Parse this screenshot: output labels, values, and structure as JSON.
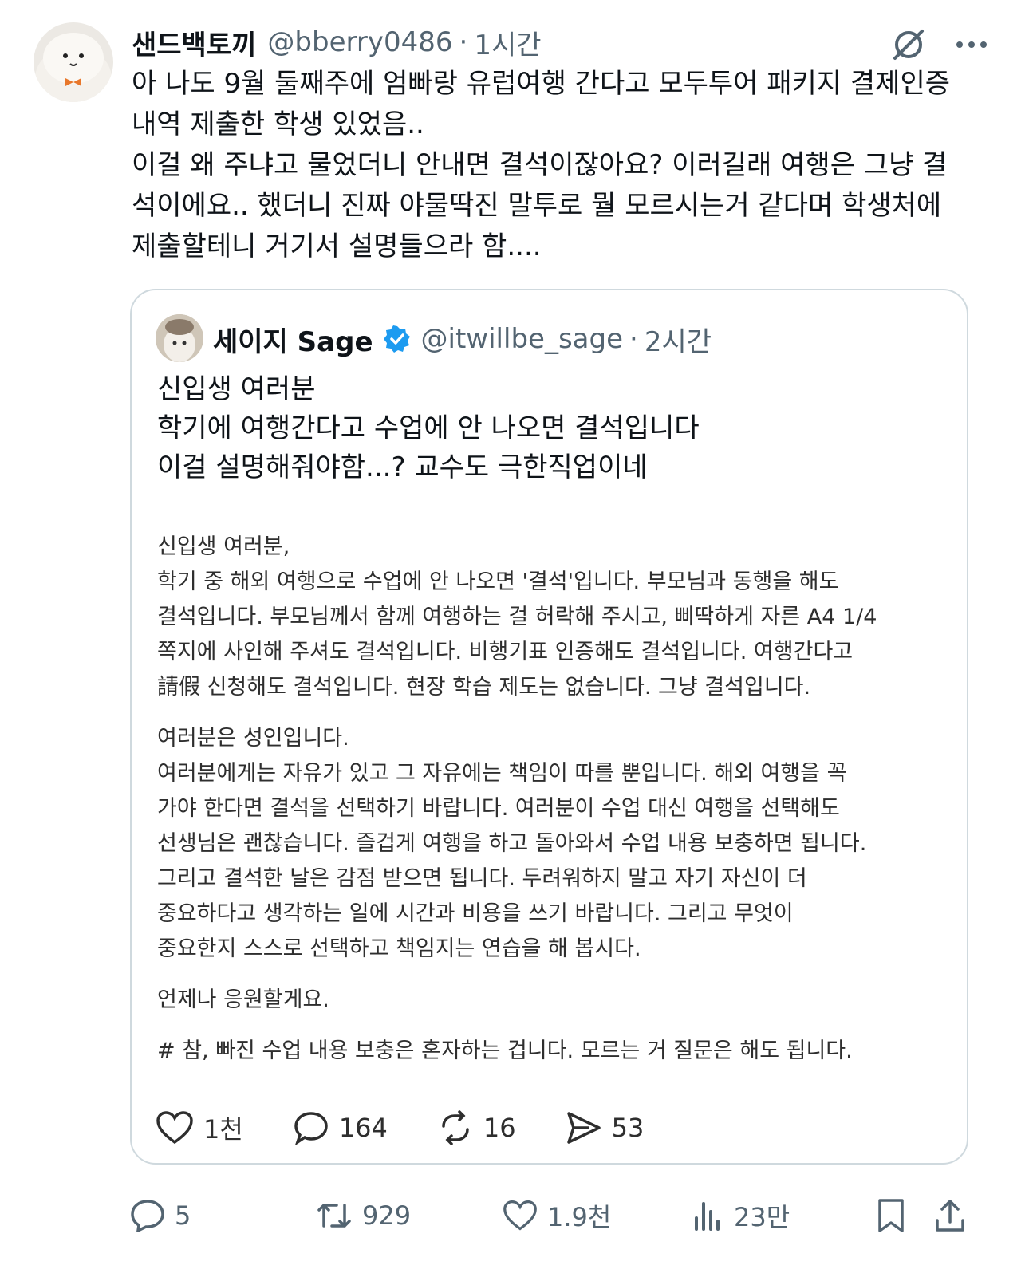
{
  "tweet": {
    "author_name": "샌드백토끼",
    "handle": "@bberry0486",
    "dot": "·",
    "time": "1시간",
    "text": "아 나도 9월 둘째주에 엄빠랑 유럽여행 간다고 모두투어 패키지 결제인증\n내역 제출한 학생 있었음..\n이걸 왜 주냐고 물었더니 안내면 결석이잖아요? 이러길래 여행은 그냥 결\n석이에요.. 했더니 진짜 야물딱진 말투로 뭘 모르시는거 같다며 학생처에\n제출할테니 거기서 설명들으라 함....",
    "icons": [
      "grok-icon",
      "more-icon"
    ]
  },
  "quote": {
    "author_name": "세이지 Sage",
    "handle": "@itwillbe_sage",
    "dot": "·",
    "time": "2시간",
    "verified_color": "#1d9bf0",
    "text": "신입생 여러분\n학기에 여행간다고 수업에 안 나오면 결석입니다\n이걸 설명해줘야함...? 교수도 극한직업이네",
    "image_paragraphs": [
      "신입생 여러분,\n학기 중 해외 여행으로 수업에 안 나오면 '결석'입니다. 부모님과 동행을 해도\n결석입니다. 부모님께서 함께 여행하는 걸 허락해 주시고, 삐딱하게 자른 A4 1/4\n쪽지에 사인해 주셔도 결석입니다. 비행기표 인증해도 결석입니다. 여행간다고\n請假 신청해도 결석입니다. 현장 학습 제도는 없습니다. 그냥 결석입니다.",
      "여러분은 성인입니다.\n여러분에게는 자유가 있고 그 자유에는 책임이 따를 뿐입니다. 해외 여행을 꼭\n가야 한다면 결석을 선택하기 바랍니다. 여러분이 수업 대신 여행을 선택해도\n선생님은 괜찮습니다. 즐겁게 여행을 하고 돌아와서 수업 내용 보충하면 됩니다.\n그리고 결석한 날은 감점 받으면 됩니다. 두려워하지 말고 자기 자신이 더\n중요하다고 생각하는 일에 시간과 비용을 쓰기 바랍니다. 그리고 무엇이\n중요한지 스스로 선택하고 책임지는 연습을 해 봅시다.",
      "언제나 응원할게요.",
      "# 참, 빠진 수업 내용 보충은 혼자하는 겁니다. 모르는 거 질문은 해도 됩니다."
    ],
    "actions": {
      "likes": "1천",
      "comments": "164",
      "retweets": "16",
      "shares": "53"
    }
  },
  "bottom_actions": {
    "replies": "5",
    "retweets": "929",
    "likes": "1.9천",
    "views": "23만"
  }
}
